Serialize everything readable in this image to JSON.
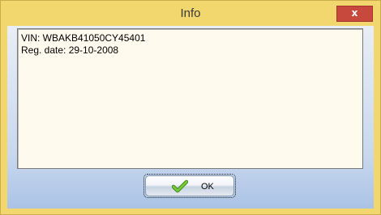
{
  "window": {
    "title": "Info",
    "close_label": "x"
  },
  "info": {
    "lines": [
      "VIN: WBAKB41050CY45401",
      "Reg. date: 29-10-2008"
    ]
  },
  "buttons": {
    "ok_label": "OK",
    "ok_icon": "checkmark-icon"
  },
  "colors": {
    "frame": "#f2d66e",
    "close_button": "#c7483d",
    "text_background": "#fffaee",
    "client_gradient_bottom": "#aac3e6",
    "check_green": "#6dbd2f"
  }
}
